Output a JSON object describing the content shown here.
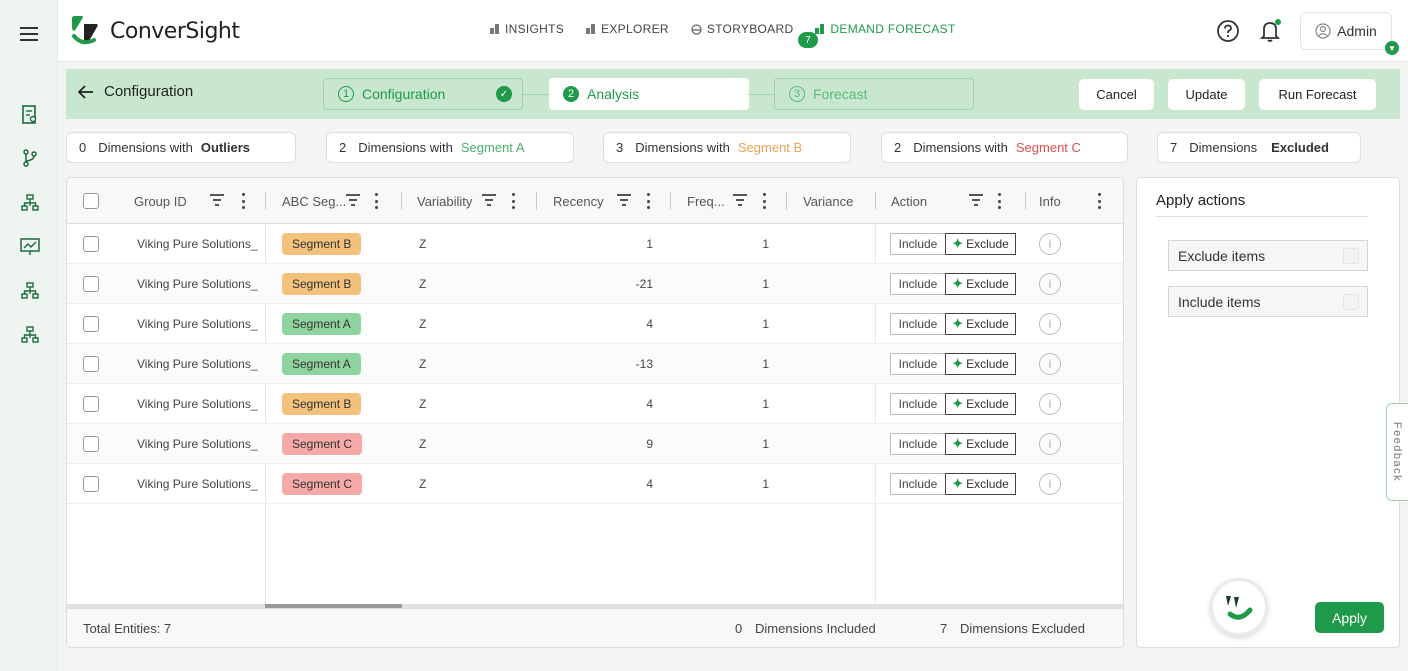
{
  "app": {
    "brand": "ConverSight"
  },
  "nav": {
    "items": [
      {
        "label": "INSIGHTS"
      },
      {
        "label": "EXPLORER"
      },
      {
        "label": "STORYBOARD"
      },
      {
        "label": "DEMAND FORECAST"
      }
    ],
    "storyboard_badge": "7"
  },
  "user": {
    "name": "Admin"
  },
  "steps": {
    "back_label": "Configuration",
    "items": [
      {
        "num": "1",
        "label": "Configuration"
      },
      {
        "num": "2",
        "label": "Analysis"
      },
      {
        "num": "3",
        "label": "Forecast"
      }
    ],
    "cancel": "Cancel",
    "update": "Update",
    "run": "Run Forecast"
  },
  "summary": [
    {
      "count": "0",
      "text": "Dimensions with",
      "category": "Outliers"
    },
    {
      "count": "2",
      "text": "Dimensions with",
      "category": "Segment A"
    },
    {
      "count": "3",
      "text": "Dimensions with",
      "category": "Segment B"
    },
    {
      "count": "2",
      "text": "Dimensions with",
      "category": "Segment C"
    },
    {
      "count": "7",
      "text": "Dimensions",
      "category": "Excluded"
    }
  ],
  "table": {
    "columns": {
      "group_id": "Group ID",
      "abc": "ABC Seg...",
      "variability": "Variability",
      "recency": "Recency",
      "frequency": "Freq...",
      "variance": "Variance",
      "action": "Action",
      "info": "Info"
    },
    "include_label": "Include",
    "exclude_label": "Exclude",
    "rows": [
      {
        "group": "Viking Pure Solutions_",
        "segment": "Segment B",
        "variability": "Z",
        "recency": "1",
        "frequency": "1"
      },
      {
        "group": "Viking Pure Solutions_",
        "segment": "Segment B",
        "variability": "Z",
        "recency": "-21",
        "frequency": "1"
      },
      {
        "group": "Viking Pure Solutions_",
        "segment": "Segment A",
        "variability": "Z",
        "recency": "4",
        "frequency": "1"
      },
      {
        "group": "Viking Pure Solutions_",
        "segment": "Segment A",
        "variability": "Z",
        "recency": "-13",
        "frequency": "1"
      },
      {
        "group": "Viking Pure Solutions_",
        "segment": "Segment B",
        "variability": "Z",
        "recency": "4",
        "frequency": "1"
      },
      {
        "group": "Viking Pure Solutions_",
        "segment": "Segment C",
        "variability": "Z",
        "recency": "9",
        "frequency": "1"
      },
      {
        "group": "Viking Pure Solutions_",
        "segment": "Segment C",
        "variability": "Z",
        "recency": "4",
        "frequency": "1"
      }
    ],
    "footer": {
      "total": "Total Entities: 7",
      "included_count": "0",
      "included_label": "Dimensions Included",
      "excluded_count": "7",
      "excluded_label": "Dimensions Excluded"
    }
  },
  "actions": {
    "title": "Apply actions",
    "exclude_items": "Exclude items",
    "include_items": "Include items",
    "apply": "Apply"
  },
  "feedback": "Feedback",
  "colors": {
    "accent": "#1f9a4a",
    "segment_a": "#8fd49e",
    "segment_b": "#f2c27d",
    "segment_c": "#f5a9a9"
  }
}
